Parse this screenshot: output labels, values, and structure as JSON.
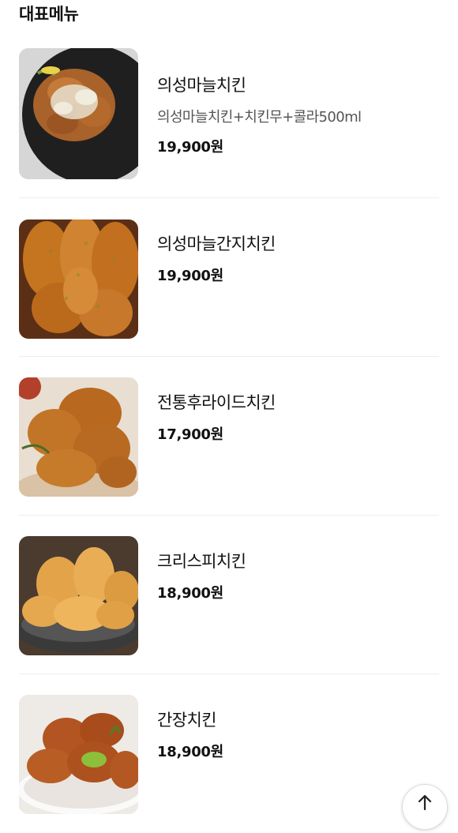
{
  "section": {
    "title": "대표메뉴"
  },
  "menu": [
    {
      "name": "의성마늘치킨",
      "desc": "의성마늘치킨+치킨무+콜라500ml",
      "price": "19,900원",
      "image": "garlic-chicken-image"
    },
    {
      "name": "의성마늘간지치킨",
      "desc": "",
      "price": "19,900원",
      "image": "garlic-ganji-chicken-image"
    },
    {
      "name": "전통후라이드치킨",
      "desc": "",
      "price": "17,900원",
      "image": "fried-chicken-image"
    },
    {
      "name": "크리스피치킨",
      "desc": "",
      "price": "18,900원",
      "image": "crispy-chicken-image"
    },
    {
      "name": "간장치킨",
      "desc": "",
      "price": "18,900원",
      "image": "soy-chicken-image"
    }
  ],
  "scroll_top": {
    "icon": "arrow-up-icon"
  }
}
